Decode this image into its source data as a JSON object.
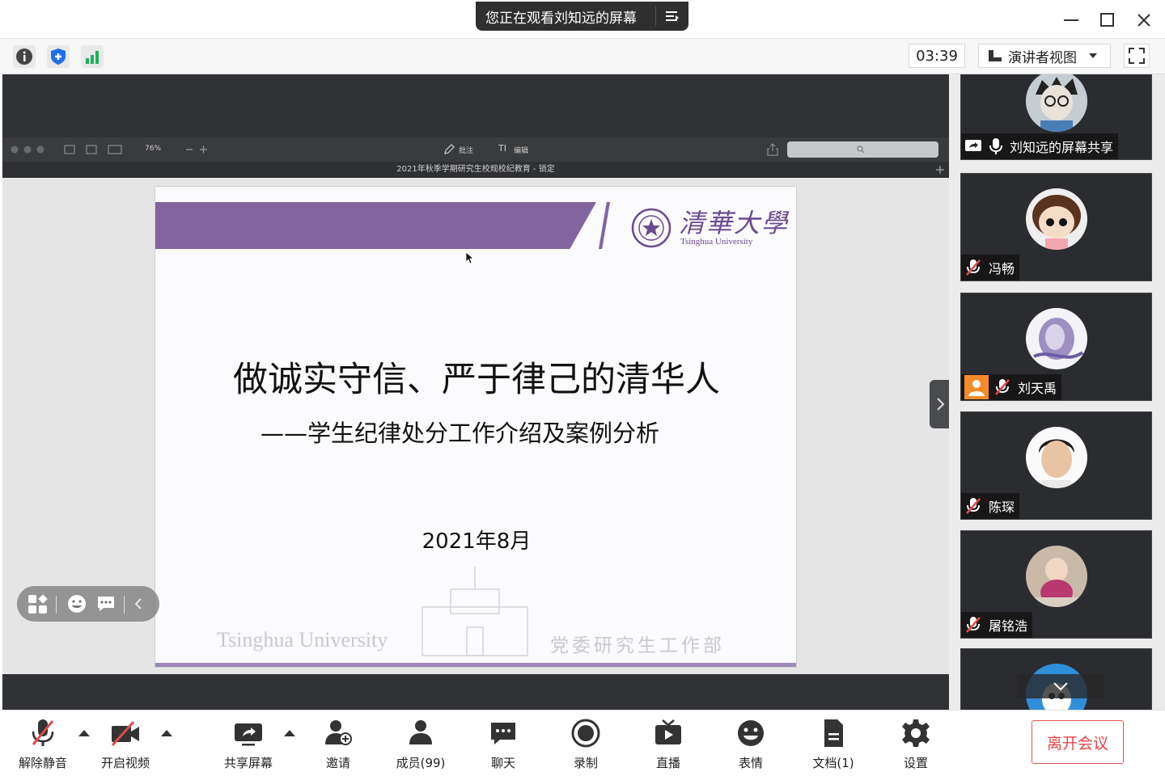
{
  "title_bar": {
    "share_notice": "您正在观看刘知远的屏幕",
    "menu_icon": "list-icon",
    "window_controls": [
      "minimize-icon",
      "maximize-icon",
      "close-icon"
    ]
  },
  "toolbar": {
    "icons": [
      "info-icon",
      "shield-icon",
      "signal-bars-icon"
    ],
    "timer": "03:39",
    "view_mode": "演讲者视图",
    "fullscreen_icon": "fullscreen-icon"
  },
  "pdf_viewer": {
    "zoom": "76%",
    "annotate_label": "批注",
    "edit_label": "编辑",
    "document_title": "2021年秋季学期研究生校规校纪教育 - 锁定"
  },
  "slide": {
    "title": "做诚实守信、严于律己的清华人",
    "subtitle": "——学生纪律处分工作介绍及案例分析",
    "date": "2021年8月",
    "logo_cn": "清華大學",
    "logo_en": "Tsinghua University",
    "footer_left": "Tsinghua University",
    "footer_right": "党委研究生工作部"
  },
  "participants": [
    {
      "name": "刘知远的屏幕共享",
      "status": "sharing"
    },
    {
      "name": "冯畅",
      "status": "muted"
    },
    {
      "name": "刘天禹",
      "status": "muted"
    },
    {
      "name": "陈琛",
      "status": "muted"
    },
    {
      "name": "屠铭浩",
      "status": "muted"
    },
    {
      "name": "",
      "status": ""
    }
  ],
  "bottom_bar": {
    "unmute": "解除静音",
    "start_video": "开启视频",
    "share_screen": "共享屏幕",
    "invite": "邀请",
    "members": "成员(99)",
    "chat": "聊天",
    "record": "录制",
    "live": "直播",
    "reactions": "表情",
    "docs": "文档(1)",
    "settings": "设置",
    "leave": "离开会议"
  },
  "colors": {
    "accent_purple": "#82659e",
    "leave_red": "#e14848",
    "signal_green": "#19b35a",
    "shield_blue": "#1f6fe6"
  }
}
